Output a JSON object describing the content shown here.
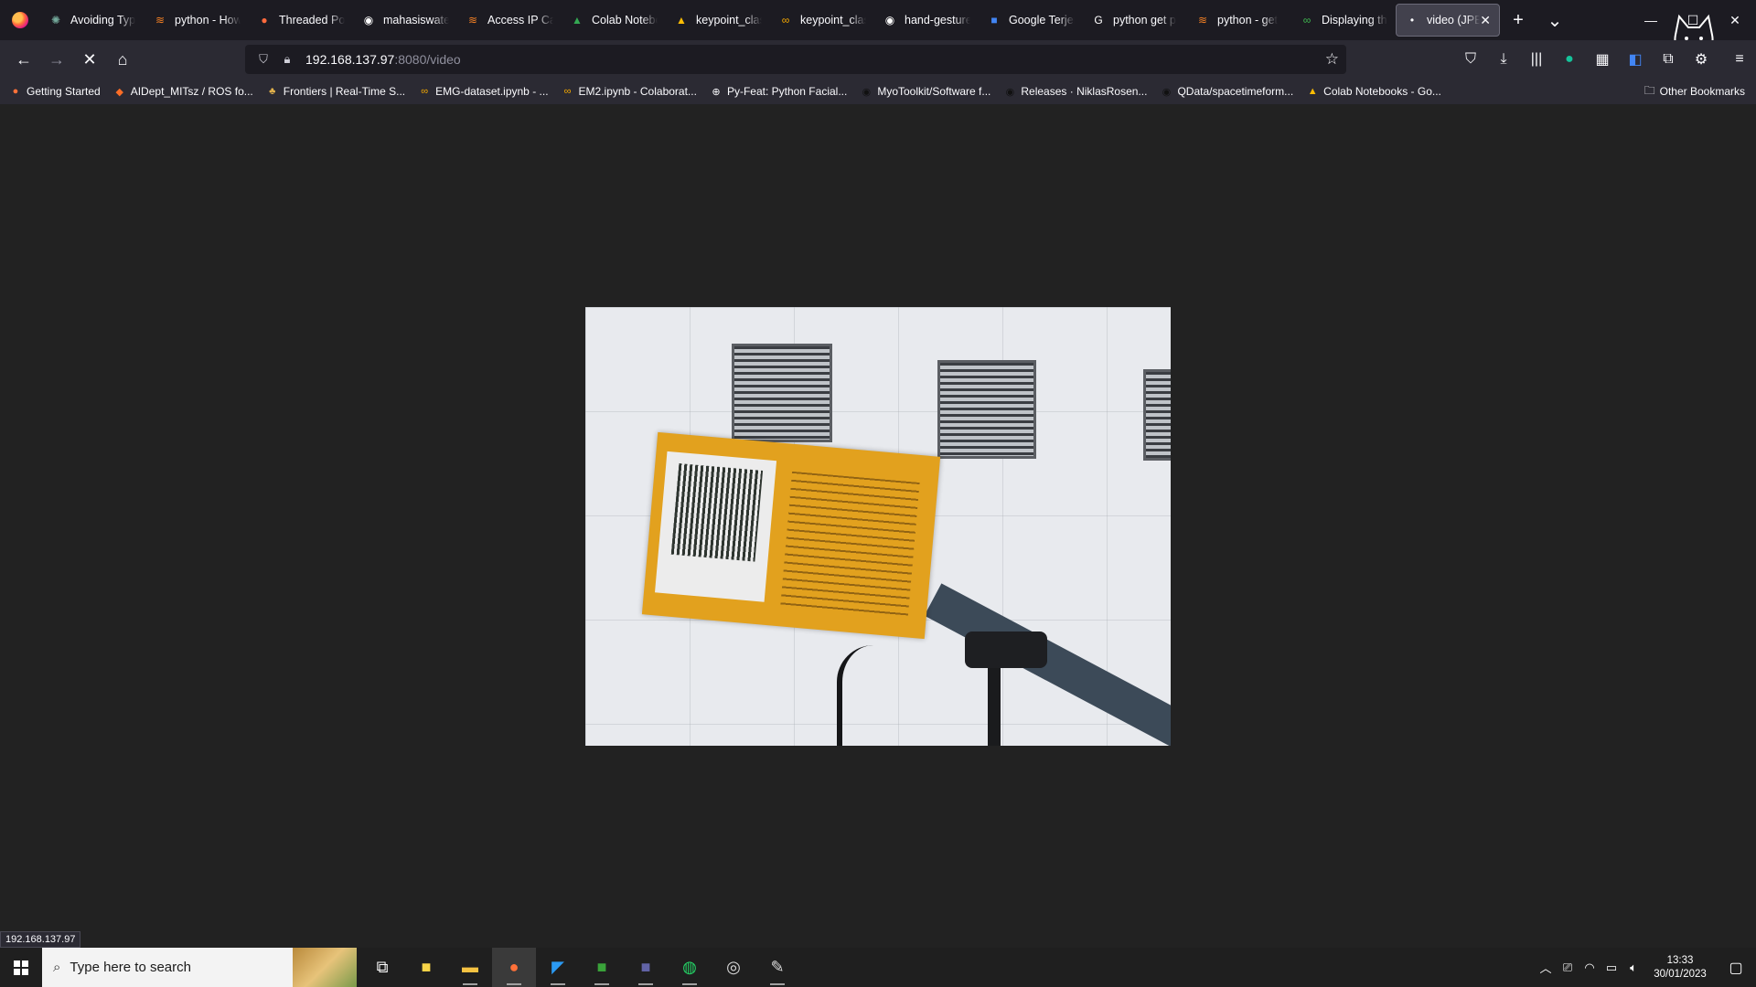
{
  "browser": {
    "tabs": [
      {
        "title": "Avoiding Typ",
        "icon": "openai-icon"
      },
      {
        "title": "python - How",
        "icon": "stackoverflow-icon"
      },
      {
        "title": "Threaded Por",
        "icon": "pin-icon"
      },
      {
        "title": "mahasiswatel",
        "icon": "github-icon"
      },
      {
        "title": "Access IP Can",
        "icon": "stackoverflow-icon"
      },
      {
        "title": "Colab Notebo",
        "icon": "drive-icon"
      },
      {
        "title": "keypoint_clas",
        "icon": "drive-icon"
      },
      {
        "title": "keypoint_clas",
        "icon": "colab-icon"
      },
      {
        "title": "hand-gesture",
        "icon": "github-icon"
      },
      {
        "title": "Google Terjem",
        "icon": "translate-icon"
      },
      {
        "title": "python get p",
        "icon": "google-icon"
      },
      {
        "title": "python - get",
        "icon": "stackoverflow-icon"
      },
      {
        "title": "Displaying th",
        "icon": "link-icon"
      },
      {
        "title": "video (JPEG",
        "icon": "dot-icon",
        "active": true
      }
    ],
    "url": {
      "host": "192.168.137.97",
      "path": ":8080/video"
    },
    "bookmarks": [
      {
        "label": "Getting Started",
        "icon": "firefox-icon"
      },
      {
        "label": "AIDept_MITsz / ROS fo...",
        "icon": "gitlab-icon"
      },
      {
        "label": "Frontiers | Real-Time S...",
        "icon": "frontiers-icon"
      },
      {
        "label": "EMG-dataset.ipynb - ...",
        "icon": "colab-icon"
      },
      {
        "label": "EM2.ipynb - Colaborat...",
        "icon": "colab-icon"
      },
      {
        "label": "Py-Feat: Python Facial...",
        "icon": "globe-icon"
      },
      {
        "label": "MyoToolkit/Software f...",
        "icon": "github-icon"
      },
      {
        "label": "Releases · NiklasRosen...",
        "icon": "github-icon"
      },
      {
        "label": "QData/spacetimeform...",
        "icon": "github-icon"
      },
      {
        "label": "Colab Notebooks - Go...",
        "icon": "drive-icon"
      }
    ],
    "other_bookmarks": "Other Bookmarks",
    "status_url": "192.168.137.97"
  },
  "taskbar": {
    "search_placeholder": "Type here to search",
    "apps": [
      "task-view-icon",
      "sticky-notes-icon",
      "file-explorer-icon",
      "firefox-icon",
      "vscode-icon",
      "excel-icon",
      "teams-icon",
      "whatsapp-icon",
      "obs-icon",
      "app-icon"
    ],
    "time": "13:33",
    "date": "30/01/2023"
  },
  "colors": {
    "tab_bg": "#1c1b22",
    "nav_bg": "#2b2a33",
    "content_bg": "#222222",
    "accent": "#ff7139"
  }
}
